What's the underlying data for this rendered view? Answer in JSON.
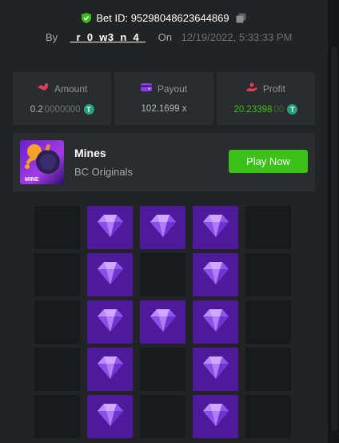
{
  "header": {
    "bet_id_label": "Bet ID: 9529804862364486​9",
    "by_label": "By",
    "username": "_r_0_w3_n_4_",
    "on_label": "On",
    "date": "12/19/2022, 5:33:33 PM"
  },
  "stats": {
    "amount": {
      "label": "Amount",
      "value_main": "0.2",
      "value_dim": "0000000",
      "icon": "amount-icon"
    },
    "payout": {
      "label": "Payout",
      "value": "102.1699 x",
      "icon": "wallet-icon"
    },
    "profit": {
      "label": "Profit",
      "value_main": "20.23398",
      "value_dim": "00",
      "icon": "profit-icon"
    }
  },
  "currency_symbol": "T",
  "game": {
    "name": "Mines",
    "provider": "BC Originals",
    "thumb_label": "MINE",
    "play_label": "Play Now"
  },
  "colors": {
    "accent_green": "#3bc117",
    "amount_icon": "#e43d5c",
    "payout_icon": "#8b3fe8",
    "profit_icon": "#e43d5c",
    "gem_tile": "#4d1a9c"
  },
  "board": {
    "rows_visible": 5,
    "columns": 5,
    "tiles": [
      "empty",
      "gem",
      "gem",
      "gem",
      "empty",
      "empty",
      "gem",
      "empty",
      "gem",
      "empty",
      "empty",
      "gem",
      "gem",
      "gem",
      "empty",
      "empty",
      "gem",
      "empty",
      "gem",
      "empty",
      "empty",
      "gem",
      "empty",
      "gem",
      "empty"
    ]
  }
}
